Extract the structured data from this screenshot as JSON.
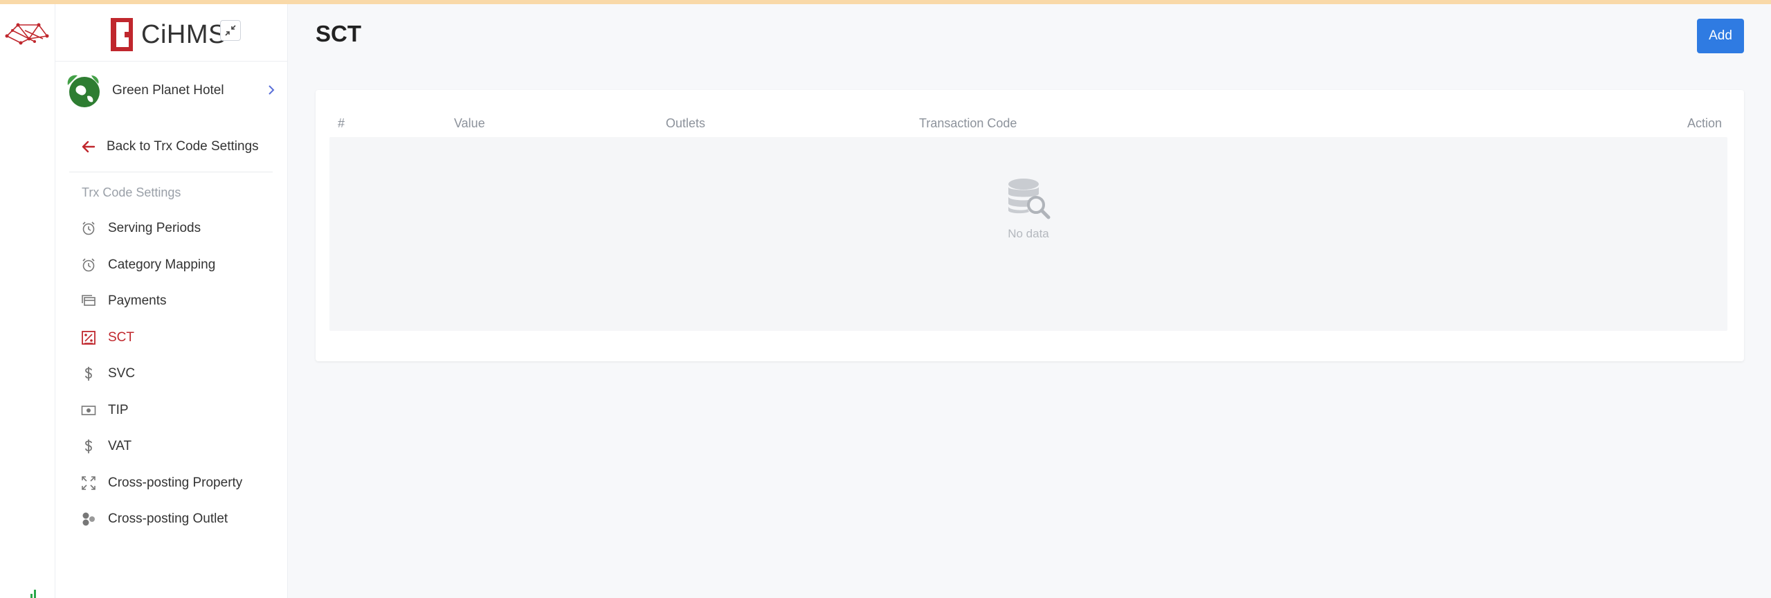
{
  "app": {
    "brand_name": "CiHMS",
    "brand_color": "#c0272d",
    "accent_color": "#2f7be2"
  },
  "sidebar": {
    "hotel_name": "Green Planet Hotel",
    "back_label": "Back to Trx Code Settings",
    "section_title": "Trx Code Settings",
    "items": [
      {
        "label": "Serving Periods",
        "icon": "alarm-clock-icon",
        "active": false
      },
      {
        "label": "Category Mapping",
        "icon": "alarm-clock-icon",
        "active": false
      },
      {
        "label": "Payments",
        "icon": "cards-icon",
        "active": false
      },
      {
        "label": "SCT",
        "icon": "receipt-percent-icon",
        "active": true
      },
      {
        "label": "SVC",
        "icon": "dollar-icon",
        "active": false
      },
      {
        "label": "TIP",
        "icon": "banknote-icon",
        "active": false
      },
      {
        "label": "VAT",
        "icon": "dollar-icon",
        "active": false
      },
      {
        "label": "Cross-posting Property",
        "icon": "expand-arrows-icon",
        "active": false
      },
      {
        "label": "Cross-posting Outlet",
        "icon": "circles-icon",
        "active": false
      }
    ]
  },
  "main": {
    "title": "SCT",
    "add_label": "Add",
    "table": {
      "columns": [
        "#",
        "Value",
        "Outlets",
        "Transaction Code",
        "Action"
      ],
      "empty_text": "No data"
    }
  }
}
